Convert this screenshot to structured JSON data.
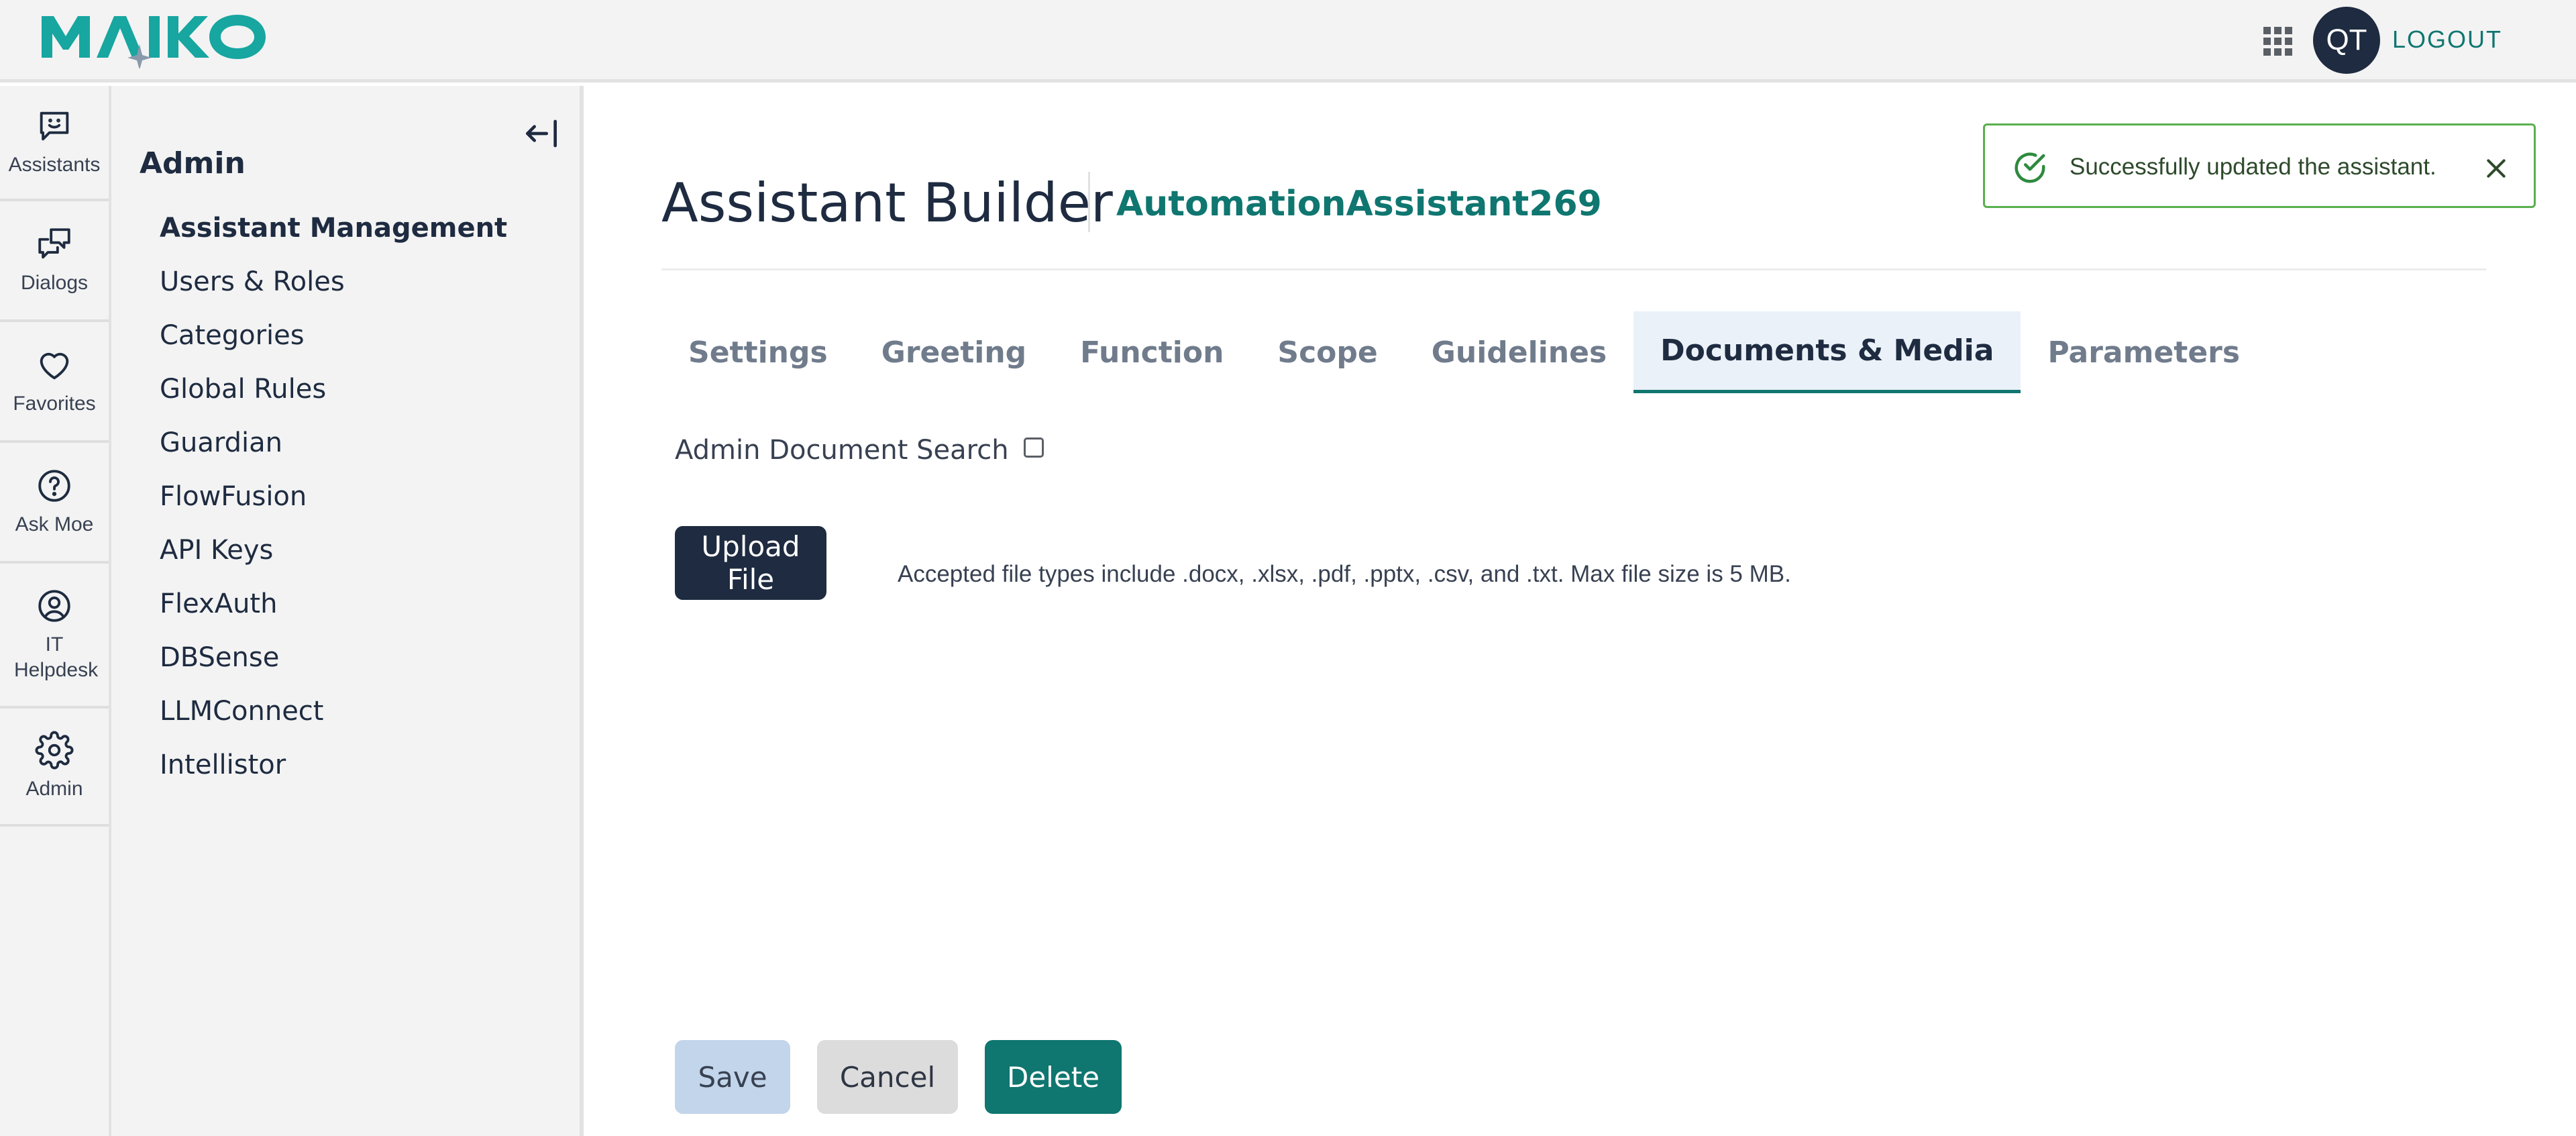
{
  "brand": {
    "logo_text": "MAIKO",
    "primary_color": "#0f7670",
    "dark_color": "#1e2b40"
  },
  "header": {
    "apps_icon": "grid-apps-icon",
    "avatar_initials": "QT",
    "logout_label": "LOGOUT"
  },
  "rail": {
    "items": [
      {
        "label": "Assistants",
        "icon": "chat-smile-icon"
      },
      {
        "label": "Dialogs",
        "icon": "dialogs-icon"
      },
      {
        "label": "Favorites",
        "icon": "heart-icon"
      },
      {
        "label": "Ask Moe",
        "icon": "help-circle-icon"
      },
      {
        "label": "IT Helpdesk",
        "icon": "user-circle-icon"
      },
      {
        "label": "Admin",
        "icon": "gear-icon"
      }
    ]
  },
  "admin_panel": {
    "title": "Admin",
    "collapse_icon": "collapse-left-icon",
    "menu": [
      {
        "label": "Assistant Management",
        "active": true
      },
      {
        "label": "Users & Roles"
      },
      {
        "label": "Categories"
      },
      {
        "label": "Global Rules"
      },
      {
        "label": "Guardian"
      },
      {
        "label": "FlowFusion"
      },
      {
        "label": "API Keys"
      },
      {
        "label": "FlexAuth"
      },
      {
        "label": "DBSense"
      },
      {
        "label": "LLMConnect"
      },
      {
        "label": "Intellistor"
      }
    ]
  },
  "main": {
    "title": "Assistant Builder",
    "assistant_name": "AutomationAssistant269",
    "tabs": [
      {
        "label": "Settings"
      },
      {
        "label": "Greeting"
      },
      {
        "label": "Function"
      },
      {
        "label": "Scope"
      },
      {
        "label": "Guidelines"
      },
      {
        "label": "Documents & Media",
        "active": true
      },
      {
        "label": "Parameters"
      }
    ],
    "doc_search_label": "Admin Document Search",
    "doc_search_checked": false,
    "upload_label": "Upload File",
    "upload_hint": "Accepted file types include .docx, .xlsx, .pdf, .pptx, .csv, and .txt. Max file size is 5 MB.",
    "save_label": "Save",
    "cancel_label": "Cancel",
    "delete_label": "Delete"
  },
  "toast": {
    "message": "Successfully updated the assistant.",
    "icon": "check-circle-icon",
    "close_icon": "close-icon",
    "color": "#59b04e"
  }
}
